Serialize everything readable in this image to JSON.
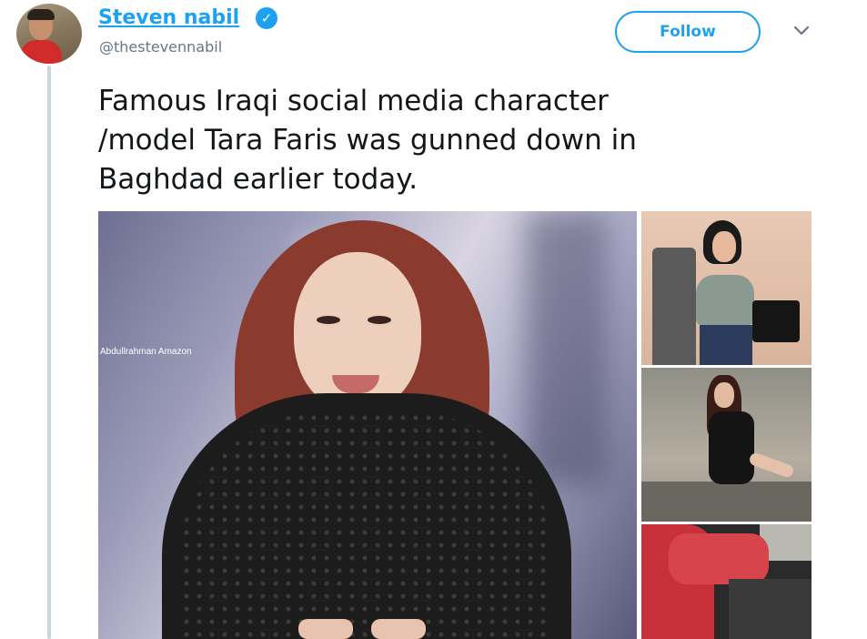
{
  "tweet": {
    "author": {
      "display_name": "Steven nabil",
      "username": "@thestevennabil",
      "verified_glyph": "✓"
    },
    "follow_label": "Follow",
    "text": "Famous Iraqi social media character\n/model Tara Faris was gunned down in\nBaghdad earlier today.",
    "photos": {
      "main_watermark": "Abdullrahman Amazon"
    }
  },
  "icons": {
    "verified": "verified-badge-icon",
    "more": "chevron-down-icon"
  },
  "colors": {
    "accent": "#1da1f2",
    "secondary_text": "#657786",
    "thread_line": "#ccd6dd"
  }
}
